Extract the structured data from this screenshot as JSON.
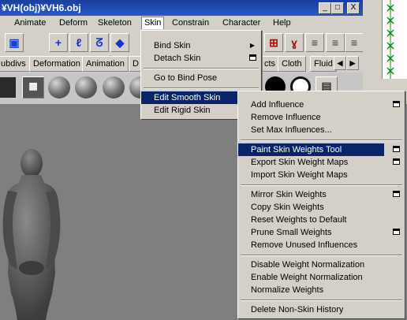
{
  "window": {
    "title": "¥VH(obj)¥VH6.obj",
    "controls": [
      "_",
      "□",
      "X"
    ]
  },
  "menubar": {
    "items": [
      "Animate",
      "Deform",
      "Skeleton",
      "Skin",
      "Constrain",
      "Character",
      "Help"
    ],
    "active": "Skin"
  },
  "shelf_tabs": [
    "ubdivs",
    "Deformation",
    "Animation",
    "D",
    "cts",
    "Cloth",
    "Fluid"
  ],
  "skin_menu": {
    "items": [
      {
        "label": "Bind Skin",
        "submenu": true
      },
      {
        "label": "Detach Skin",
        "option": true
      },
      {
        "label": "Go to Bind Pose"
      },
      {
        "label": "Edit Smooth Skin",
        "submenu": true,
        "highlighted": true
      },
      {
        "label": "Edit Rigid Skin",
        "submenu": true
      }
    ]
  },
  "edit_smooth_skin_menu": {
    "items": [
      {
        "label": "Add Influence",
        "option": true
      },
      {
        "label": "Remove Influence"
      },
      {
        "label": "Set Max Influences..."
      },
      {
        "label": "Paint Skin Weights Tool",
        "option": true,
        "highlighted": true
      },
      {
        "label": "Export Skin Weight Maps",
        "option": true
      },
      {
        "label": "Import Skin Weight Maps"
      },
      {
        "label": "Mirror Skin Weights",
        "option": true
      },
      {
        "label": "Copy Skin Weights"
      },
      {
        "label": "Reset Weights to Default"
      },
      {
        "label": "Prune Small Weights",
        "option": true
      },
      {
        "label": "Remove Unused Influences"
      },
      {
        "label": "Disable Weight Normalization"
      },
      {
        "label": "Enable Weight Normalization"
      },
      {
        "label": "Normalize Weights"
      },
      {
        "label": "Delete Non-Skin History"
      }
    ]
  },
  "colors": {
    "menu_bg": "#d4d0c8",
    "highlight": "#0a246a",
    "viewport": "#7f7f7f",
    "titlebar": "#2a58c8"
  }
}
